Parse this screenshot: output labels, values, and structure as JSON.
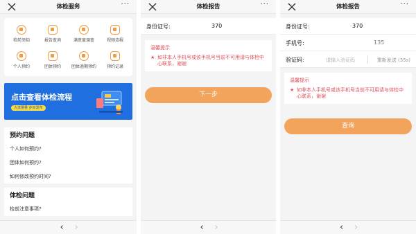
{
  "panel1": {
    "title": "体检服务",
    "more": "···",
    "grid": [
      {
        "label": "检前须知",
        "icon": "shield-icon"
      },
      {
        "label": "报告查询",
        "icon": "report-icon"
      },
      {
        "label": "满意度调查",
        "icon": "smile-icon"
      },
      {
        "label": "视频流程",
        "icon": "video-icon"
      },
      {
        "label": "个人预约",
        "icon": "person-icon"
      },
      {
        "label": "团体预约",
        "icon": "group-icon"
      },
      {
        "label": "团体逾期预约",
        "icon": "clock-icon"
      },
      {
        "label": "预约记录",
        "icon": "calendar-icon"
      }
    ],
    "banner": {
      "title": "点击查看体检流程",
      "sub": "大流量量  步目发布"
    },
    "faq1": {
      "heading": "预约问题",
      "items": [
        "个人如何预约?",
        "团体如何预约?",
        "如何修改预约时间?"
      ]
    },
    "faq2": {
      "heading": "体检问题",
      "items": [
        "检前注意事项?"
      ]
    }
  },
  "panel2": {
    "title": "体检报告",
    "more": "···",
    "id_label": "身份证号:",
    "id_value": "370",
    "tip_title": "温馨提示",
    "tip_text": "如非本人手机号或该手机号当前不可用请与体检中心联系，谢谢",
    "button": "下一步"
  },
  "panel3": {
    "title": "体检报告",
    "more": "···",
    "id_label": "身份证号:",
    "id_value": "370",
    "phone_label": "手机号:",
    "phone_value": "135",
    "code_label": "验证码:",
    "code_placeholder": "请输入验证码",
    "resend": "重新发送 (35s)",
    "tip_title": "温馨提示",
    "tip_text": "如非本人手机号或该手机号当前不可用请与体检中心联系，谢谢",
    "button": "查询"
  },
  "nav": {
    "back": "‹",
    "forward": "›"
  },
  "star": "★",
  "colors": {
    "accent": "#f2a45c",
    "tip": "#e0505c",
    "banner": "#1f6fe0"
  }
}
